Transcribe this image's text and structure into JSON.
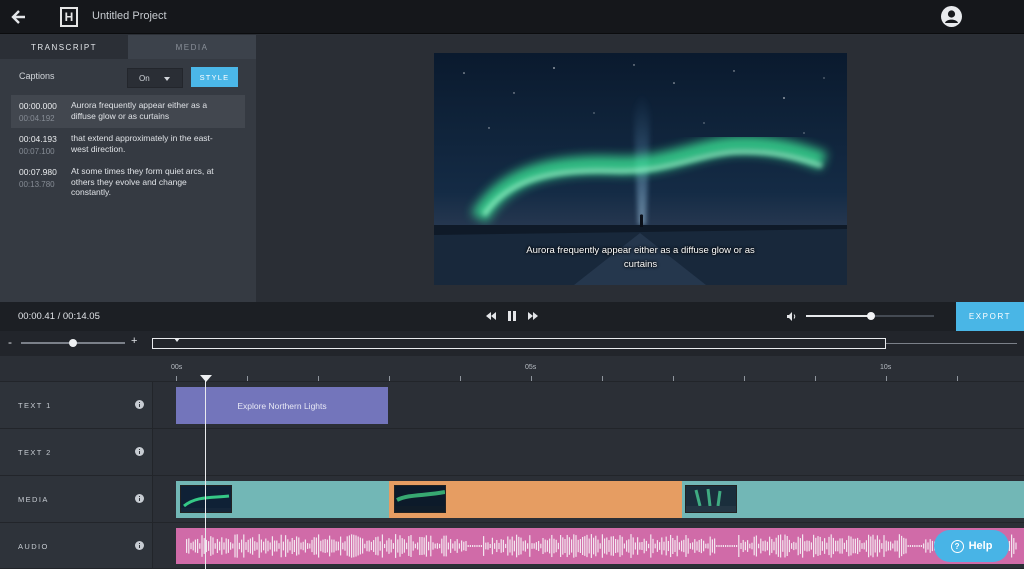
{
  "header": {
    "logo_letter": "H",
    "project_title": "Untitled Project",
    "back_icon": "arrow-left-icon",
    "account_icon": "user-avatar-icon"
  },
  "left_panel": {
    "tabs": [
      {
        "label": "TRANSCRIPT",
        "active": true
      },
      {
        "label": "MEDIA",
        "active": false
      }
    ],
    "captions_label": "Captions",
    "captions_value": "On",
    "style_button": "STYLE",
    "cues": [
      {
        "start": "00:00.000",
        "end": "00:04.192",
        "text": "Aurora frequently appear either as a diffuse glow or as curtains",
        "active": true
      },
      {
        "start": "00:04.193",
        "end": "00:07.100",
        "text": "that extend approximately in the east-west direction.",
        "active": false
      },
      {
        "start": "00:07.980",
        "end": "00:13.780",
        "text": "At some times they form quiet arcs, at others they evolve and change constantly.",
        "active": false
      }
    ]
  },
  "preview": {
    "subtitle": "Aurora frequently appear either as a diffuse glow or as curtains"
  },
  "controls": {
    "timecode": "00:00.41 / 00:14.05",
    "rewind_icon": "rewind-icon",
    "pause_icon": "pause-icon",
    "forward_icon": "fast-forward-icon",
    "volume_icon": "volume-icon",
    "volume_level": 0.51,
    "export_label": "EXPORT"
  },
  "zoom": {
    "minus": "-",
    "plus": "+",
    "level": 0.5
  },
  "ruler": {
    "labels": [
      "00s",
      "05s",
      "10s"
    ]
  },
  "tracks": [
    {
      "label": "TEXT 1",
      "clip_label": "Explore Northern Lights"
    },
    {
      "label": "TEXT 2"
    },
    {
      "label": "MEDIA"
    },
    {
      "label": "AUDIO"
    }
  ],
  "colors": {
    "accent": "#49b6e6",
    "text_clip": "#7375bb",
    "media_teal": "#72b7b6",
    "media_orange": "#e69d62",
    "audio_pink": "#d06ba8"
  },
  "help_label": "Help"
}
